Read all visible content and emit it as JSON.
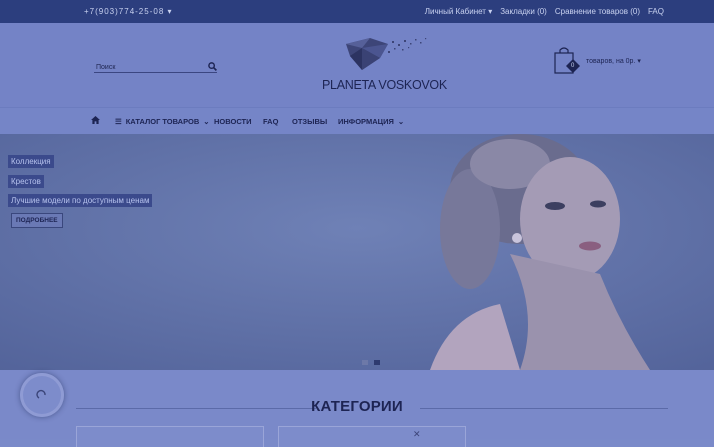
{
  "topbar": {
    "phone": "+7(903)774-25-08",
    "account": "Личный Кабинет",
    "bookmarks": "Закладки (0)",
    "compare": "Сравнение товаров (0)",
    "faq": "FAQ"
  },
  "header": {
    "search_placeholder": "Поиск",
    "logo_text": "PLANETA VOSKOVOK",
    "cart_label": "товаров, на 0р.",
    "cart_count": "0"
  },
  "nav": {
    "catalog": "КАТАЛОГ ТОВАРОВ",
    "news": "НОВОСТИ",
    "faq": "FAQ",
    "reviews": "ОТЗЫВЫ",
    "info": "ИНФОРМАЦИЯ"
  },
  "hero": {
    "caption1": "Коллекция",
    "caption2": "Крестов",
    "caption3": "Лучшие модели по доступным ценам",
    "button": "ПОДРОБНЕЕ"
  },
  "categories": {
    "title": "КАТЕГОРИИ"
  },
  "colors": {
    "topbar": "#2c3e7e",
    "header": "#7483c6",
    "accent": "#1d2453"
  }
}
